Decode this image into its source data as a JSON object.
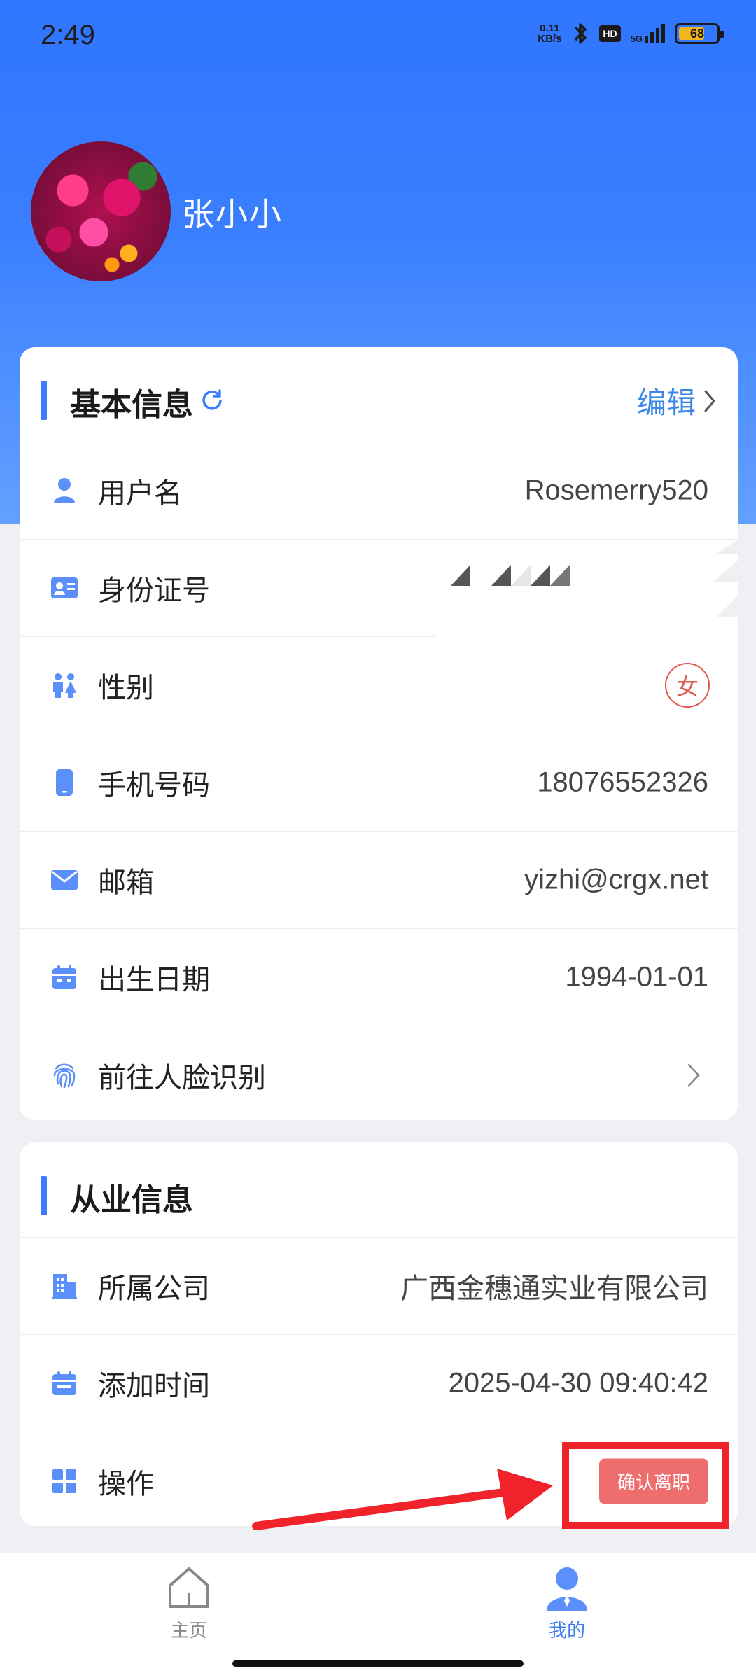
{
  "status_bar": {
    "time": "2:49",
    "net_speed_value": "0.11",
    "net_speed_unit": "KB/s",
    "hd": "HD",
    "signal": "5G",
    "battery": "68"
  },
  "profile": {
    "name": "张小小"
  },
  "basic_info": {
    "title": "基本信息",
    "edit_label": "编辑",
    "rows": [
      {
        "label": "用户名",
        "value": "Rosemerry520"
      },
      {
        "label": "身份证号",
        "value": ""
      },
      {
        "label": "性别",
        "value": "女"
      },
      {
        "label": "手机号码",
        "value": "18076552326"
      },
      {
        "label": "邮箱",
        "value": "yizhi@crgx.net"
      },
      {
        "label": "出生日期",
        "value": "1994-01-01"
      },
      {
        "label": "前往人脸识别",
        "value": ""
      }
    ]
  },
  "work_info": {
    "title": "从业信息",
    "rows": [
      {
        "label": "所属公司",
        "value": "广西金穗通实业有限公司"
      },
      {
        "label": "添加时间",
        "value": "2025-04-30 09:40:42"
      },
      {
        "label": "操作",
        "value": "确认离职"
      }
    ]
  },
  "tabbar": {
    "home_label": "主页",
    "mine_label": "我的"
  },
  "colors": {
    "accent": "#3d7bff",
    "danger": "#ee6d6d",
    "annotation": "#f0232b"
  }
}
